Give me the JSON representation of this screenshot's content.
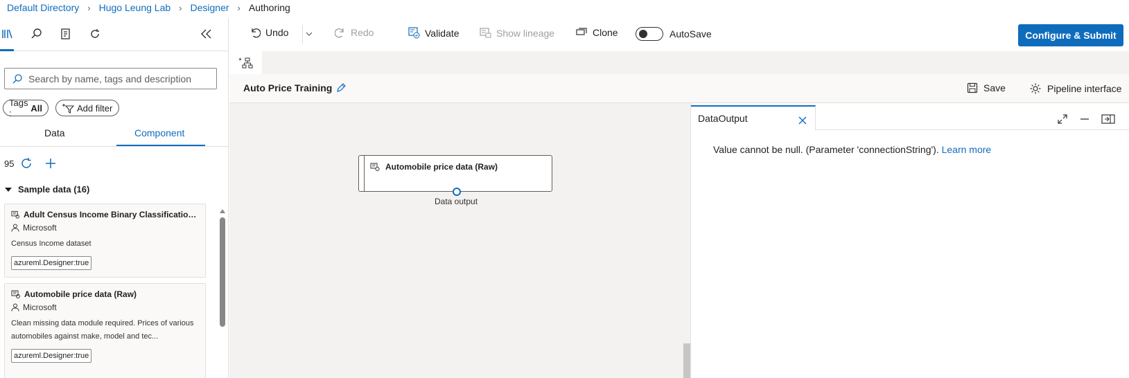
{
  "breadcrumb": {
    "items": [
      "Default Directory",
      "Hugo Leung Lab",
      "Designer"
    ],
    "current": "Authoring"
  },
  "left_panel": {
    "icons": [
      "library-icon",
      "search-icon",
      "clipboard-icon",
      "refresh-icon"
    ],
    "search_placeholder": "Search by name, tags and description",
    "tags_pill": {
      "label": "Tags :",
      "value": "All"
    },
    "add_filter_label": "Add filter",
    "tabs": [
      "Data",
      "Component"
    ],
    "active_tab": "Component",
    "count": "95",
    "section": {
      "label": "Sample data (16)"
    },
    "cards": [
      {
        "title": "Adult Census Income Binary Classification da...",
        "author": "Microsoft",
        "description": "Census Income dataset",
        "tag": "azureml.Designer:true"
      },
      {
        "title": "Automobile price data (Raw)",
        "author": "Microsoft",
        "description": "Clean missing data module required. Prices of various automobiles against make, model and tec...",
        "tag": "azureml.Designer:true"
      }
    ]
  },
  "toolbar": {
    "undo_label": "Undo",
    "redo_label": "Redo",
    "validate_label": "Validate",
    "show_lineage_label": "Show lineage",
    "clone_label": "Clone",
    "autosave_label": "AutoSave",
    "submit_label": "Configure & Submit"
  },
  "doc_tab": {
    "label": "*"
  },
  "pipeline": {
    "title": "Auto Price Training",
    "save_label": "Save",
    "interface_label": "Pipeline interface"
  },
  "canvas": {
    "node_title": "Automobile price data (Raw)",
    "port_label": "Data output"
  },
  "right_panel": {
    "tab_label": "DataOutput",
    "message": "Value cannot be null. (Parameter 'connectionString').",
    "learn_more": "Learn more"
  },
  "colors": {
    "accent": "#0f6cbd",
    "canvas_bg": "#f3f2f1"
  }
}
